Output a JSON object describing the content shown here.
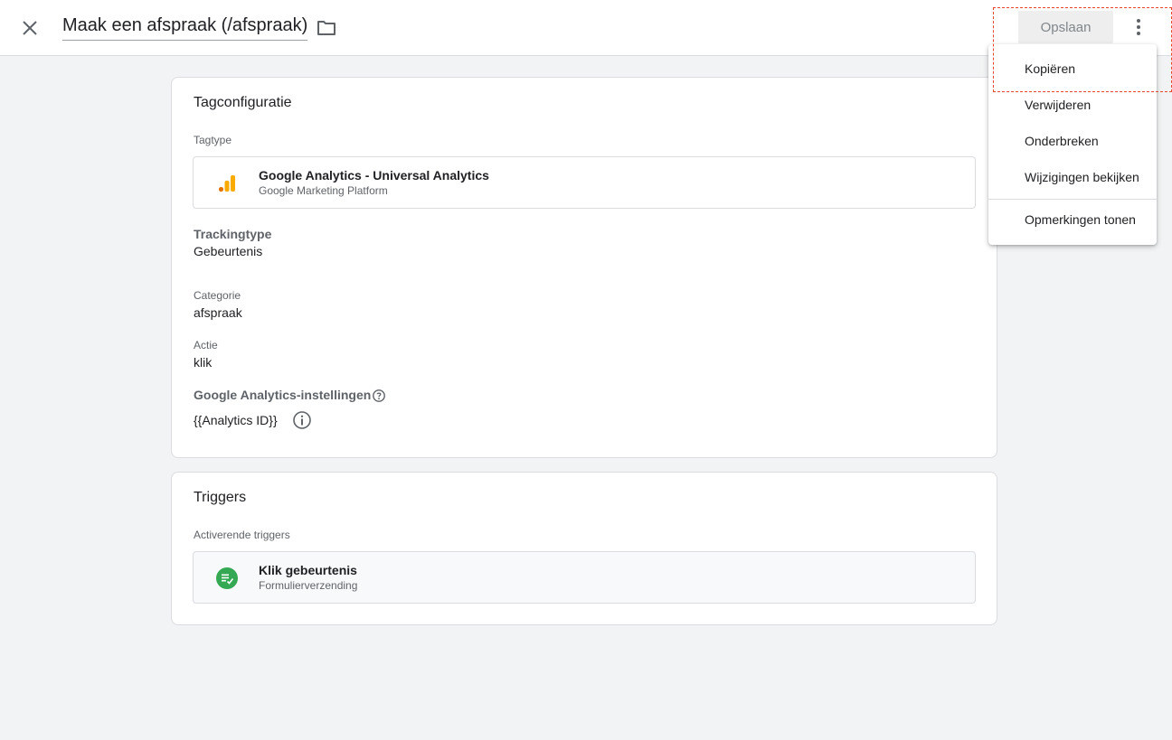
{
  "header": {
    "title": "Maak een afspraak (/afspraak)",
    "save_label": "Opslaan"
  },
  "tag_config": {
    "title": "Tagconfiguratie",
    "tagtype_label": "Tagtype",
    "tagtype_name": "Google Analytics - Universal Analytics",
    "tagtype_vendor": "Google Marketing Platform",
    "tracking_label": "Trackingtype",
    "tracking_value": "Gebeurtenis",
    "category_label": "Categorie",
    "category_value": "afspraak",
    "action_label": "Actie",
    "action_value": "klik",
    "ga_settings_label": "Google Analytics-instellingen",
    "ga_settings_value": "{{Analytics ID}}"
  },
  "triggers": {
    "title": "Triggers",
    "active_label": "Activerende triggers",
    "trigger_name": "Klik gebeurtenis",
    "trigger_type": "Formulierverzending"
  },
  "menu": {
    "items": [
      {
        "label": "Kopiëren"
      },
      {
        "label": "Verwijderen"
      },
      {
        "label": "Onderbreken"
      },
      {
        "label": "Wijzigingen bekijken"
      },
      {
        "label": "Opmerkingen tonen"
      }
    ]
  },
  "icons": {
    "close": "close-icon",
    "folder": "folder-icon",
    "more": "more-vert-icon",
    "analytics": "analytics-bars-icon",
    "help": "help-circle-icon",
    "info": "info-circle-icon",
    "trigger": "form-submit-icon"
  },
  "colors": {
    "analytics_orange": "#F9AB00",
    "analytics_dark_orange": "#E37400",
    "trigger_green": "#34A853",
    "highlight_red": "#E8472B"
  }
}
